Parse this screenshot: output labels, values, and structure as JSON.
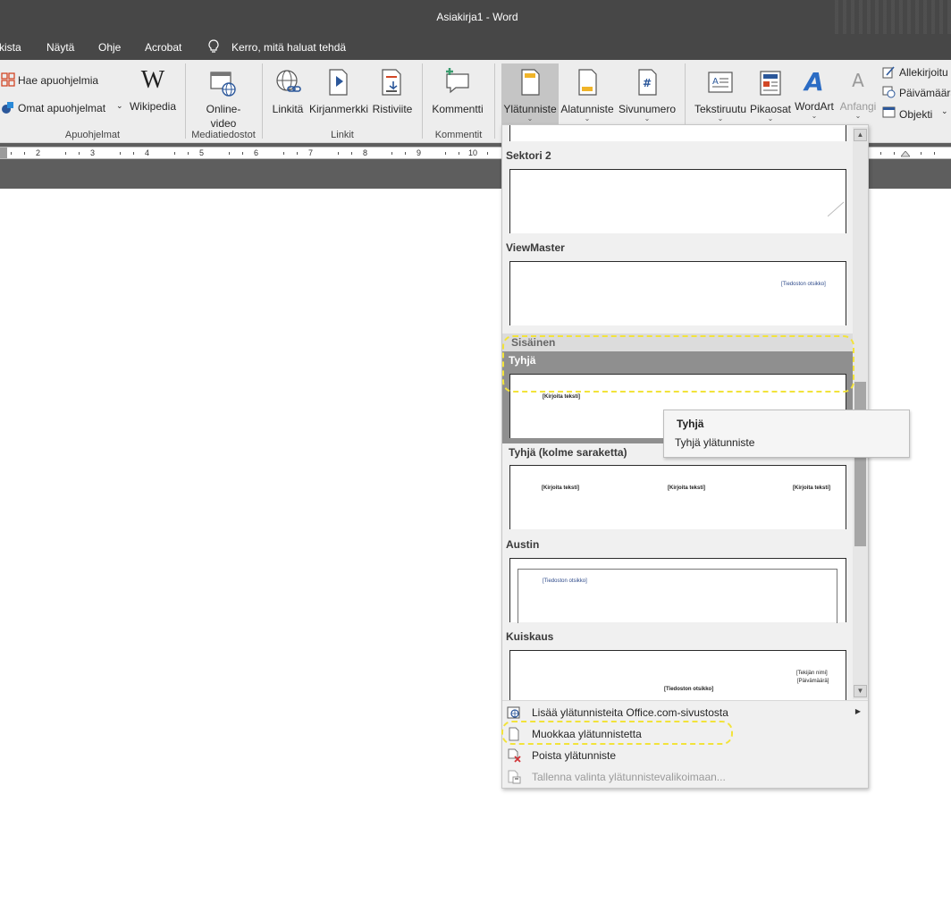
{
  "window": {
    "title": "Asiakirja1  -  Word"
  },
  "menubar": {
    "items": [
      "kista",
      "Näytä",
      "Ohje",
      "Acrobat"
    ],
    "tell_me": "Kerro, mitä haluat tehdä"
  },
  "ribbon": {
    "apuohjelmat": {
      "get_addins": "Hae apuohjelmia",
      "my_addins": "Omat apuohjelmat",
      "wikipedia": "Wikipedia",
      "group_label": "Apuohjelmat"
    },
    "media": {
      "online_video_line1": "Online-",
      "online_video_line2": "video",
      "group_label": "Mediatiedostot"
    },
    "links": {
      "link": "Linkitä",
      "bookmark": "Kirjanmerkki",
      "cross_ref": "Ristiviite",
      "group_label": "Linkit"
    },
    "comments": {
      "comment": "Kommentti",
      "group_label": "Kommentit"
    },
    "header_footer": {
      "header": "Ylätunniste",
      "footer": "Alatunniste",
      "page_number": "Sivunumero"
    },
    "text": {
      "text_box": "Tekstiruutu",
      "quick_parts": "Pikaosat",
      "wordart": "WordArt",
      "drop_cap": "Anfangi",
      "signature": "Allekirjoitu",
      "date_time": "Päivämäärä",
      "object": "Objekti"
    }
  },
  "ruler": {
    "numbers": [
      "2",
      "3",
      "4",
      "5",
      "6",
      "7",
      "8",
      "9",
      "10"
    ]
  },
  "gallery": {
    "items": [
      {
        "title": "Sektori 2"
      },
      {
        "title": "ViewMaster",
        "placeholder": "[Tiedoston otsikko]"
      },
      {
        "title": "Tyhjä",
        "placeholder": "[Kirjoita teksti]"
      },
      {
        "title": "Tyhjä (kolme saraketta)",
        "placeholders": [
          "[Kirjoita teksti]",
          "[Kirjoita teksti]",
          "[Kirjoita teksti]"
        ]
      },
      {
        "title": "Austin",
        "placeholder": "[Tiedoston otsikko]"
      },
      {
        "title": "Kuiskaus",
        "author": "[Tekijän nimi]",
        "date": "[Päivämäärä]",
        "placeholder": "[Tiedoston otsikko]"
      }
    ],
    "section_header": "Sisäinen",
    "tooltip": {
      "title": "Tyhjä",
      "body": "Tyhjä ylätunniste"
    }
  },
  "dropdown_menu": {
    "more_headers": "Lisää ylätunnisteita Office.com-sivustosta",
    "edit_header": "Muokkaa ylätunnistetta",
    "remove_header": "Poista ylätunniste",
    "save_selection": "Tallenna valinta ylätunnistevalikoimaan..."
  },
  "colors": {
    "highlight": "#f2e33a",
    "titlebar": "#474747",
    "ribbon": "#ededed",
    "accent_blue": "#2b579a"
  }
}
